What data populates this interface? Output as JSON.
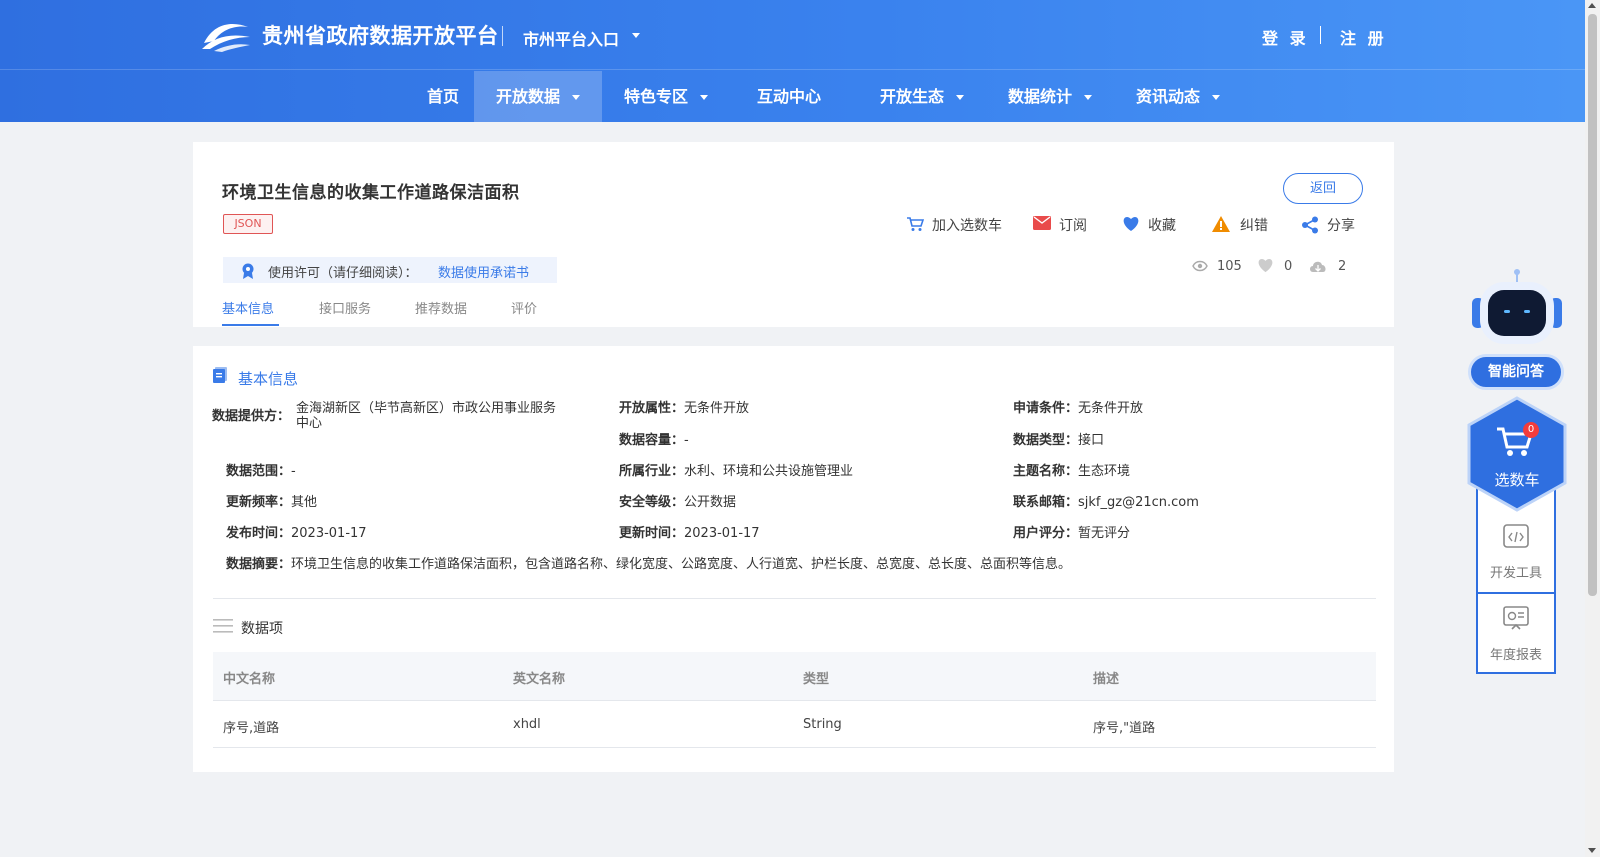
{
  "header": {
    "site_title": "贵州省政府数据开放平台",
    "city_entry": "市州平台入口",
    "login": "登 录",
    "register": "注 册"
  },
  "nav": [
    {
      "label": "首页"
    },
    {
      "label": "开放数据"
    },
    {
      "label": "特色专区"
    },
    {
      "label": "互动中心"
    },
    {
      "label": "开放生态"
    },
    {
      "label": "数据统计"
    },
    {
      "label": "资讯动态"
    }
  ],
  "dataset": {
    "title": "环境卫生信息的收集工作道路保洁面积",
    "format_tag": "JSON",
    "back": "返回",
    "actions": {
      "cart": "加入选数车",
      "subscribe": "订阅",
      "favorite": "收藏",
      "report": "纠错",
      "share": "分享"
    },
    "license_text": "使用许可（请仔细阅读）：",
    "license_link": "数据使用承诺书",
    "stats": {
      "views": "105",
      "likes": "0",
      "downloads": "2"
    },
    "tabs": [
      "基本信息",
      "接口服务",
      "推荐数据",
      "评价"
    ]
  },
  "basic_info": {
    "section_title": "基本信息",
    "fields": {
      "provider_label": "数据提供方：",
      "provider_line1": "金海湖新区（毕节高新区）市政公用事业服务",
      "provider_line2": "中心",
      "open_attr_label": "开放属性：",
      "open_attr": "无条件开放",
      "apply_cond_label": "申请条件：",
      "apply_cond": "无条件开放",
      "capacity_label": "数据容量：",
      "capacity": "-",
      "data_type_label": "数据类型：",
      "data_type": "接口",
      "scope_label": "数据范围：",
      "scope": "-",
      "industry_label": "所属行业：",
      "industry": "水利、环境和公共设施管理业",
      "theme_label": "主题名称：",
      "theme": "生态环境",
      "freq_label": "更新频率：",
      "freq": "其他",
      "security_label": "安全等级：",
      "security": "公开数据",
      "email_label": "联系邮箱：",
      "email": "sjkf_gz@21cn.com",
      "publish_label": "发布时间：",
      "publish": "2023-01-17",
      "update_label": "更新时间：",
      "update": "2023-01-17",
      "rating_label": "用户评分：",
      "rating": "暂无评分",
      "summary_label": "数据摘要：",
      "summary": "环境卫生信息的收集工作道路保洁面积，包含道路名称、绿化宽度、公路宽度、人行道宽、护栏长度、总宽度、总长度、总面积等信息。"
    }
  },
  "data_items": {
    "title": "数据项",
    "columns": [
      "中文名称",
      "英文名称",
      "类型",
      "描述"
    ],
    "rows": [
      [
        "序号,道路",
        "xhdl",
        "String",
        "序号,\"道路"
      ]
    ]
  },
  "float": {
    "ai": "智能问答",
    "cart": "选数车",
    "cart_count": "0",
    "dev_tools": "开发工具",
    "annual_report": "年度报表"
  },
  "colors": {
    "primary": "#3a7be8",
    "header_start": "#2f6fe0",
    "header_end": "#4a96f6",
    "tag_red": "#e05555"
  }
}
